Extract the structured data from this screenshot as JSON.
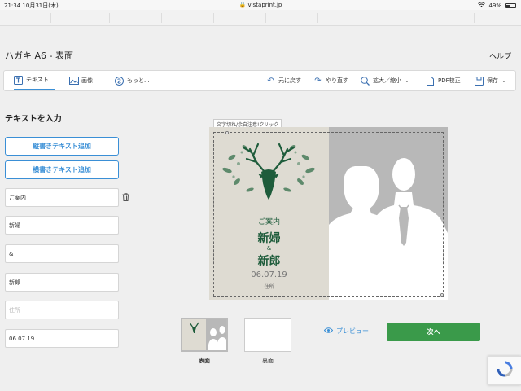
{
  "status_bar": {
    "time": "21:34",
    "date": "10月31日(木)",
    "url": "vistaprint.jp",
    "battery": "49%",
    "battery_level": 0.49
  },
  "header": {
    "title": "ハガキ A6 - 表面",
    "help": "ヘルプ"
  },
  "toolbar": {
    "text": "テキスト",
    "image": "画像",
    "more": "もっと...",
    "undo": "元に戻す",
    "redo": "やり直す",
    "zoom": "拡大／縮小",
    "pdf": "PDF校正",
    "save": "保存"
  },
  "panel": {
    "heading": "テキストを入力",
    "add_vertical": "縦書きテキスト追加",
    "add_horizontal": "横書きテキスト追加",
    "fields": [
      {
        "value": "ご案内",
        "placeholder": ""
      },
      {
        "value": "新婦",
        "placeholder": ""
      },
      {
        "value": "&",
        "placeholder": ""
      },
      {
        "value": "新郎",
        "placeholder": ""
      },
      {
        "value": "",
        "placeholder": "住所"
      },
      {
        "value": "06.07.19",
        "placeholder": ""
      }
    ]
  },
  "canvas": {
    "tooltip": "文字切れ/余白注意!クリック",
    "greeting": "ご案内",
    "bride": "新婦",
    "amp": "&",
    "groom": "新郎",
    "date": "06.07.19",
    "address": "住所"
  },
  "thumbnails": {
    "front": "表面",
    "back": "裏面"
  },
  "actions": {
    "preview": "プレビュー",
    "next": "次へ"
  },
  "colors": {
    "accent": "#3a8fd6",
    "next": "#3a9a4a",
    "card_green": "#1e5c3b"
  }
}
